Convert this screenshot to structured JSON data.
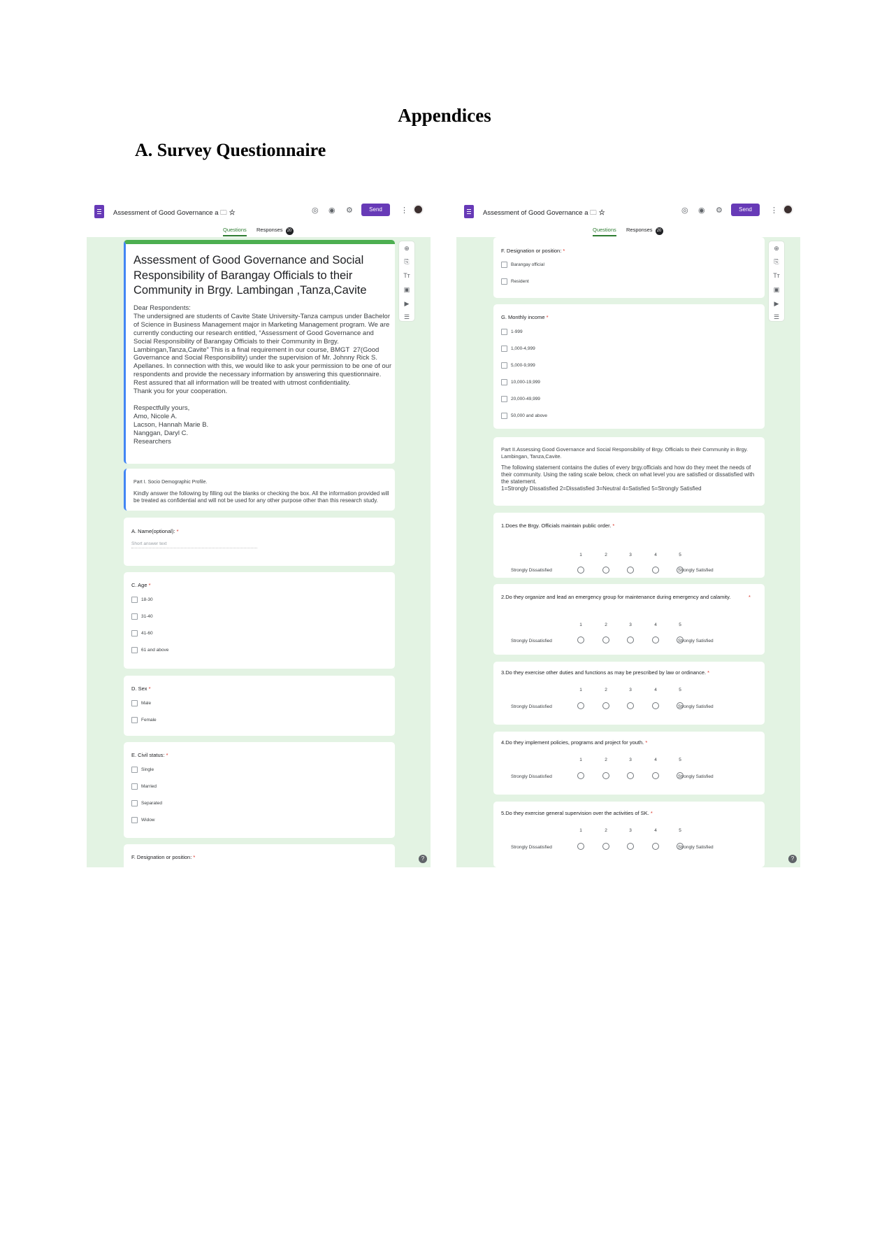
{
  "document": {
    "heading": "Appendices",
    "subheading": "A.  Survey Questionnaire"
  },
  "app": {
    "form_name": "Assessment of Good Governance a",
    "send_label": "Send",
    "tab_questions": "Questions",
    "tab_responses": "Responses",
    "responses_count": "20",
    "accent_color": "#673ab7",
    "canvas_color": "#e3f3e3"
  },
  "left": {
    "title": "Assessment of Good Governance and Social Responsibility of Barangay Officials to their Community in Brgy. Lambingan ,Tanza,Cavite",
    "description": "Dear Respondents:\nThe undersigned are students of Cavite State University-Tanza campus under Bachelor of Science in Business Management major in Marketing Management program. We are currently conducting our research entitled, “Assessment of Good Governance and Social Responsibility of Barangay Officials to their Community in Brgy. Lambingan,Tanza,Cavite” This is a final requirement in our course, BMGT  27(Good Governance and Social Responsibility) under the supervision of Mr. Johnny Rick S. Apellanes. In connection with this, we would like to ask your permission to be one of our respondents and provide the necessary information by answering this questionnaire. Rest assured that all information will be treated with utmost confidentiality.\nThank you for your cooperation.\n\nRespectfully yours,\nAmo, Nicole A.\nLacson, Hannah Marie B.\nNanggan, Daryl C.\nResearchers",
    "part1_title": "Part I. Socio Demographic Profile.",
    "part1_body": "Kindly answer the following by filling out the blanks or checking the box. All the information provided will be treated as confidential and will not be used for any other purpose other than this research study.",
    "name_question": "A.  Name(optional):",
    "short_answer": "Short answer text",
    "age_question": "C.  Age",
    "age_options": [
      "18-30",
      "31-40",
      "41-60",
      "61 and above"
    ],
    "sex_question": "D.  Sex",
    "sex_options": [
      "Male",
      "Female"
    ],
    "civil_question": "E.  Civil status:",
    "civil_options": [
      "Single",
      "Married",
      "Separated",
      "Widow"
    ],
    "designation_question": "F.  Designation or position:"
  },
  "right": {
    "designation_question": "F.  Designation or position:",
    "designation_options": [
      "Barangay official",
      "Resident"
    ],
    "income_question": "G.  Monthly income",
    "income_options": [
      "1-999",
      "1,000-4,999",
      "5,000-9,999",
      "10,000-19,999",
      "20,000-49,999",
      "50,000 and above"
    ],
    "part2_title": "Part II.Assessing Good Governance and Social Responsibility of Brgy. Officials  to their Community in Brgy. Lambingan, Tanza,Cavite.",
    "part2_body": "The following statement contains the duties of every brgy.officials and how do they meet the needs of their community. Using the rating scale below, check on what level you are satisfied or dissatisfied with the statement.\n1=Strongly Dissatisfied 2=Dissatisfied 3=Neutral 4=Satisfied 5=Strongly Satisfied",
    "scale_low": "Strongly Dissatisfied",
    "scale_high": "Strongly Satisfied",
    "scale_numbers": [
      "1",
      "2",
      "3",
      "4",
      "5"
    ],
    "scale_questions": [
      "1.Does  the Brgy. Officials maintain public order.",
      "2.Do they organize and lead an emergency group for maintenance during emergency and calamity.",
      "3.Do they exercise other duties and functions as may be prescribed by law or ordinance.",
      "4.Do they implement policies, programs and project for youth.",
      "5.Do they exercise general supervision over the activities of SK."
    ]
  }
}
